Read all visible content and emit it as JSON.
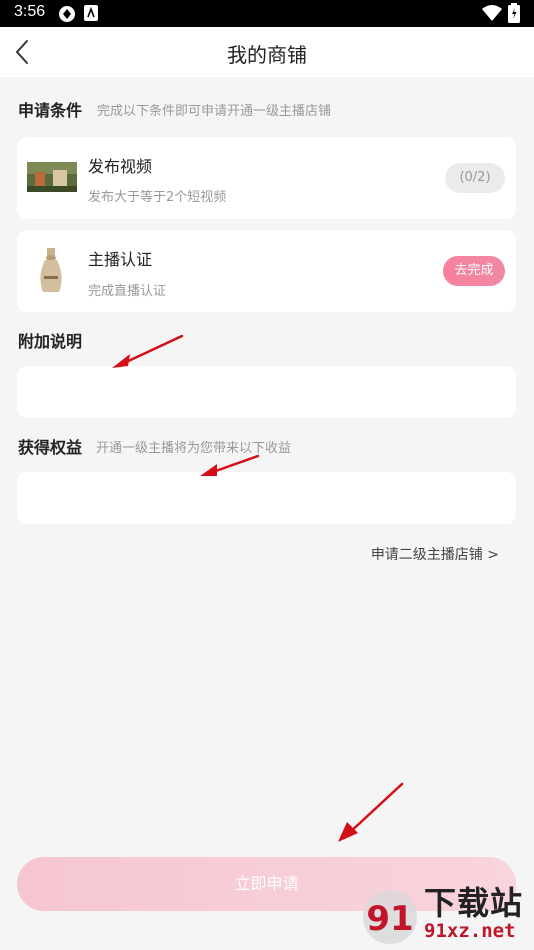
{
  "status_bar": {
    "time": "3:56"
  },
  "header": {
    "title": "我的商铺"
  },
  "conditions": {
    "title": "申请条件",
    "subtitle": "完成以下条件即可申请开通一级主播店铺",
    "items": [
      {
        "title": "发布视频",
        "desc": "发布大于等于2个短视频",
        "status": "(0/2)"
      },
      {
        "title": "主播认证",
        "desc": "完成直播认证",
        "status": "去完成"
      }
    ]
  },
  "additional": {
    "title": "附加说明"
  },
  "benefits": {
    "title": "获得权益",
    "subtitle": "开通一级主播将为您带来以下收益"
  },
  "secondary_link": "申请二级主播店铺 >",
  "submit": {
    "label": "立即申请"
  },
  "watermark": {
    "text": "下载站",
    "url": "91xz.net",
    "logo": "91"
  },
  "colors": {
    "accent": "#f77f9d",
    "submit_bg": "#f6c6d0",
    "arrow": "#e0121a"
  }
}
